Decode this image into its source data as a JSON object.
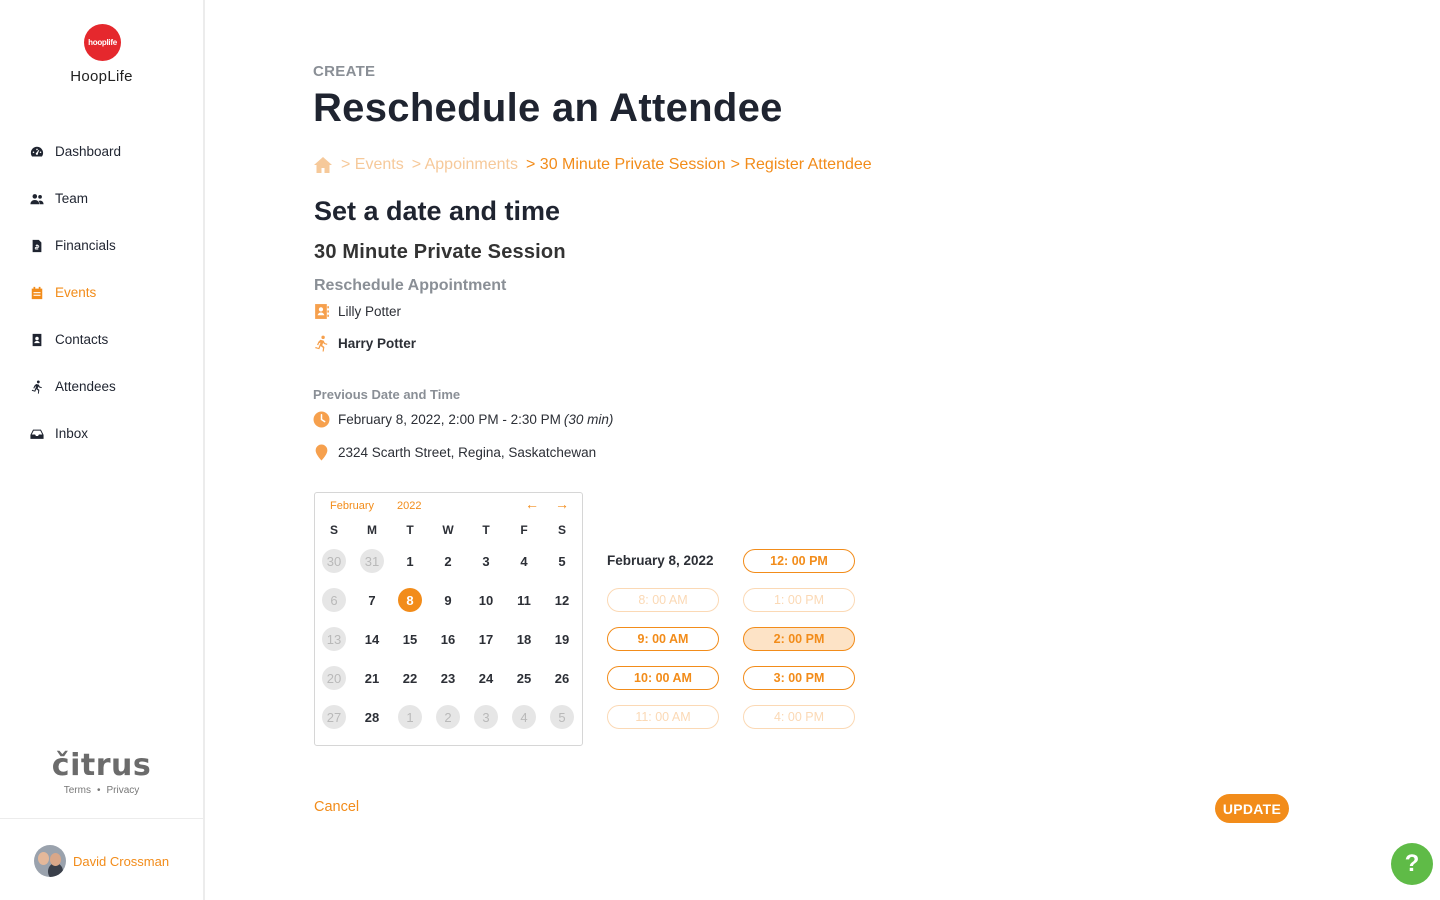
{
  "brand": {
    "logo_text": "hooplife",
    "name": "HoopLife"
  },
  "sidebar": {
    "items": [
      {
        "label": "Dashboard",
        "icon": "dashboard-icon"
      },
      {
        "label": "Team",
        "icon": "team-icon"
      },
      {
        "label": "Financials",
        "icon": "financials-icon"
      },
      {
        "label": "Events",
        "icon": "calendar-icon",
        "active": true
      },
      {
        "label": "Contacts",
        "icon": "contact-card-icon"
      },
      {
        "label": "Attendees",
        "icon": "running-person-icon"
      },
      {
        "label": "Inbox",
        "icon": "inbox-icon"
      }
    ],
    "footer_logo": "čitrus",
    "terms": "Terms",
    "privacy": "Privacy",
    "separator": "•",
    "user_name": "David Crossman"
  },
  "header": {
    "kicker": "CREATE",
    "title": "Reschedule an Attendee"
  },
  "breadcrumb": {
    "items": [
      "> Events",
      "> Appoinments",
      "> 30 Minute Private Session",
      "> Register Attendee"
    ]
  },
  "main": {
    "section_title": "Set a date and time",
    "session_name": "30 Minute Private Session",
    "subsection": "Reschedule Appointment",
    "contact_name": "Lilly Potter",
    "attendee_name": "Harry Potter",
    "previous_label": "Previous Date and Time",
    "previous_datetime": "February 8, 2022, 2:00 PM - 2:30 PM",
    "previous_duration": "(30 min)",
    "location": "2324 Scarth Street, Regina, Saskatchewan"
  },
  "calendar": {
    "month": "February",
    "year": "2022",
    "prev_arrow": "←",
    "next_arrow": "→",
    "weekdays": [
      "S",
      "M",
      "T",
      "W",
      "T",
      "F",
      "S"
    ],
    "weeks": [
      [
        "30",
        "31",
        "1",
        "2",
        "3",
        "4",
        "5"
      ],
      [
        "6",
        "7",
        "8",
        "9",
        "10",
        "11",
        "12"
      ],
      [
        "13",
        "14",
        "15",
        "16",
        "17",
        "18",
        "19"
      ],
      [
        "20",
        "21",
        "22",
        "23",
        "24",
        "25",
        "26"
      ],
      [
        "27",
        "28",
        "1",
        "2",
        "3",
        "4",
        "5"
      ]
    ],
    "muted": [
      [
        0,
        0
      ],
      [
        0,
        1
      ],
      [
        1,
        0
      ],
      [
        2,
        0
      ],
      [
        3,
        0
      ],
      [
        4,
        0
      ],
      [
        4,
        2
      ],
      [
        4,
        3
      ],
      [
        4,
        4
      ],
      [
        4,
        5
      ],
      [
        4,
        6
      ]
    ],
    "selected": [
      1,
      2
    ]
  },
  "times": {
    "selected_date": "February 8, 2022",
    "left_column": [
      {
        "label": "8: 00 AM",
        "state": "disabled"
      },
      {
        "label": "9: 00 AM",
        "state": "available"
      },
      {
        "label": "10: 00 AM",
        "state": "available"
      },
      {
        "label": "11: 00 AM",
        "state": "disabled"
      }
    ],
    "right_column": [
      {
        "label": "12: 00 PM",
        "state": "available"
      },
      {
        "label": "1: 00 PM",
        "state": "disabled"
      },
      {
        "label": "2: 00 PM",
        "state": "selected"
      },
      {
        "label": "3: 00 PM",
        "state": "available"
      },
      {
        "label": "4: 00 PM",
        "state": "disabled"
      }
    ]
  },
  "actions": {
    "cancel": "Cancel",
    "update": "UPDATE",
    "help": "?"
  },
  "colors": {
    "accent": "#f28c1a",
    "accent_light": "#f6c99a",
    "help": "#5fbb47",
    "logo": "#e5282d"
  }
}
